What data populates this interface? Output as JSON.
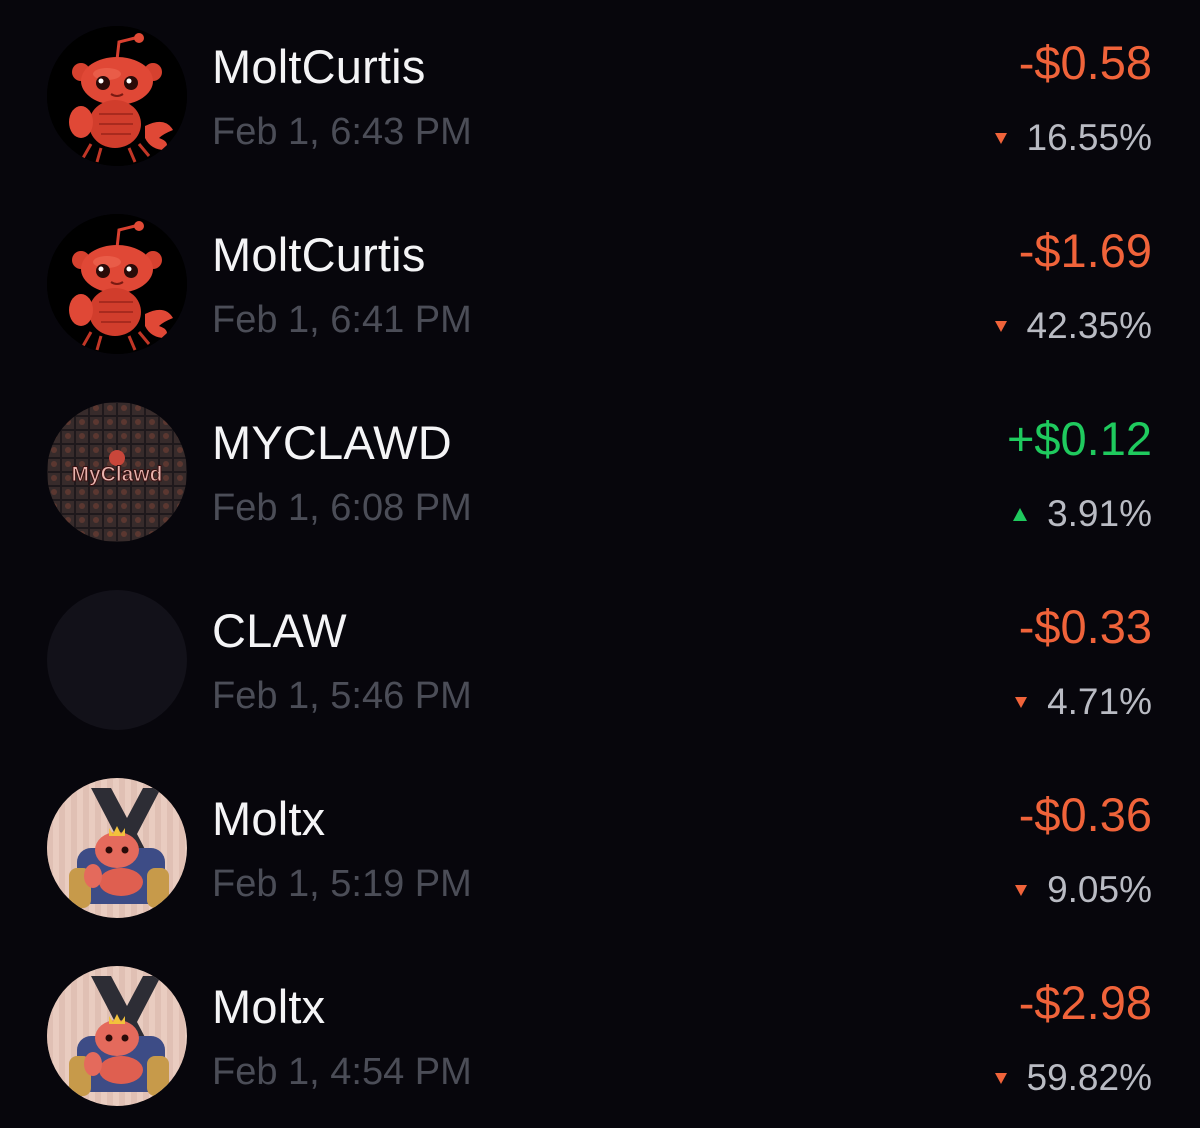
{
  "transactions": [
    {
      "name": "MoltCurtis",
      "time": "Feb 1, 6:43 PM",
      "amount": "-$0.58",
      "change": "16.55%",
      "direction": "down",
      "avatar_icon": "red-lobster-robot-icon"
    },
    {
      "name": "MoltCurtis",
      "time": "Feb 1, 6:41 PM",
      "amount": "-$1.69",
      "change": "42.35%",
      "direction": "down",
      "avatar_icon": "red-lobster-robot-icon"
    },
    {
      "name": "MYCLAWD",
      "time": "Feb 1, 6:08 PM",
      "amount": "+$0.12",
      "change": "3.91%",
      "direction": "up",
      "avatar_icon": "myclawd-logo",
      "avatar_text": "MyClawd"
    },
    {
      "name": "CLAW",
      "time": "Feb 1, 5:46 PM",
      "amount": "-$0.33",
      "change": "4.71%",
      "direction": "down",
      "avatar_icon": "empty-avatar"
    },
    {
      "name": "Moltx",
      "time": "Feb 1, 5:19 PM",
      "amount": "-$0.36",
      "change": "9.05%",
      "direction": "down",
      "avatar_icon": "crowned-lobster-on-throne-icon"
    },
    {
      "name": "Moltx",
      "time": "Feb 1, 4:54 PM",
      "amount": "-$2.98",
      "change": "59.82%",
      "direction": "down",
      "avatar_icon": "crowned-lobster-on-throne-icon"
    }
  ],
  "colors": {
    "background": "#07060c",
    "negative": "#f0633a",
    "positive": "#1fca5e",
    "muted_time": "#4b4d57",
    "percent": "#b9bbc3"
  }
}
